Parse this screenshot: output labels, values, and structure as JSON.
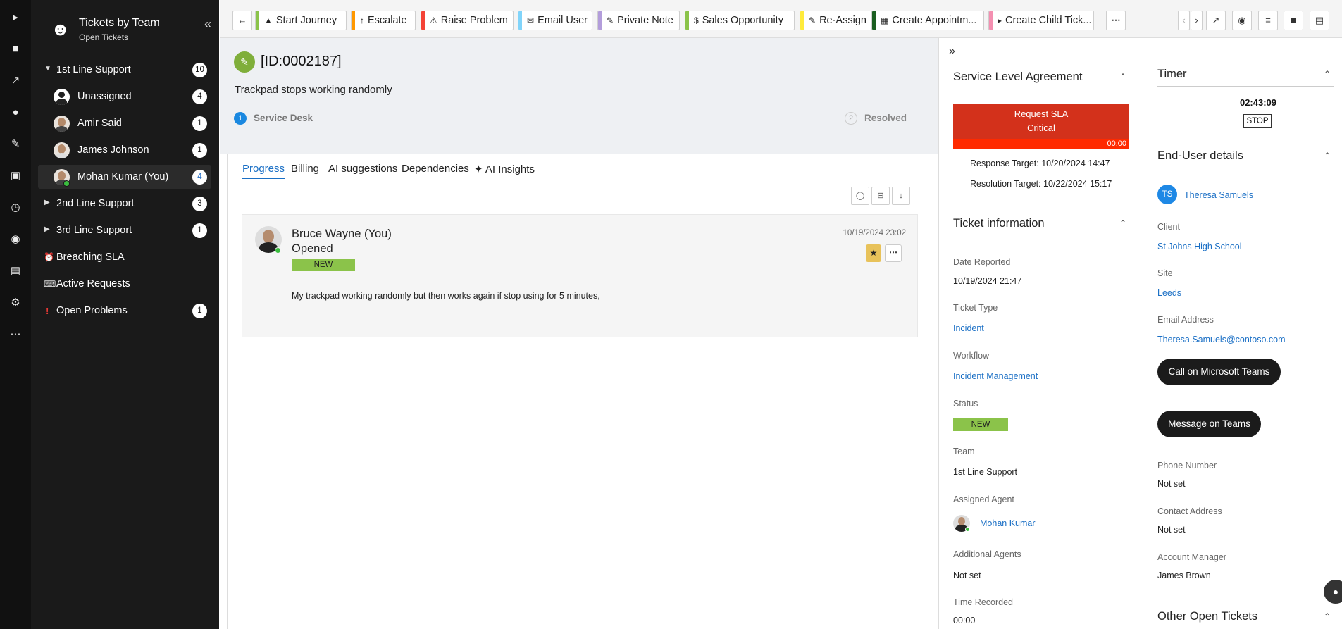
{
  "sidebar": {
    "title": "Tickets by Team",
    "subtitle": "Open Tickets",
    "items": [
      {
        "label": "1st Line Support",
        "count": "10"
      },
      {
        "label": "Unassigned",
        "count": "4"
      },
      {
        "label": "Amir Said",
        "count": "1"
      },
      {
        "label": "James Johnson",
        "count": "1"
      },
      {
        "label": "Mohan Kumar (You)",
        "count": "4"
      },
      {
        "label": "2nd Line Support",
        "count": "3"
      },
      {
        "label": "3rd Line Support",
        "count": "1"
      },
      {
        "label": "Breaching SLA",
        "count": ""
      },
      {
        "label": "Active Requests",
        "count": ""
      },
      {
        "label": "Open Problems",
        "count": "1"
      }
    ]
  },
  "toolbar": {
    "actions": [
      {
        "label": "Start Journey",
        "color": "#8bc34a",
        "icon": "car-icon"
      },
      {
        "label": "Escalate",
        "color": "#ff9800",
        "icon": "arrow-up-icon"
      },
      {
        "label": "Raise Problem",
        "color": "#f44336",
        "icon": "warning-icon"
      },
      {
        "label": "Email User",
        "color": "#81d4fa",
        "icon": "email-icon"
      },
      {
        "label": "Private Note",
        "color": "#b39ddb",
        "icon": "note-icon"
      },
      {
        "label": "Sales Opportunity",
        "color": "#8bc34a",
        "icon": "dollar-icon"
      },
      {
        "label": "Re-Assign",
        "color": "#ffeb3b",
        "icon": "edit-icon"
      },
      {
        "label": "Create Appointm...",
        "color": "#1b5e20",
        "icon": "calendar-icon"
      },
      {
        "label": "Create Child Tick...",
        "color": "#f48fb1",
        "icon": "ticket-icon"
      }
    ]
  },
  "ticket": {
    "id": "[ID:0002187]",
    "title": "Trackpad stops working randomly",
    "steps": [
      {
        "num": "1",
        "label": "Service Desk"
      },
      {
        "num": "2",
        "label": "Resolved"
      }
    ],
    "tabs": [
      "Progress",
      "Billing",
      "AI suggestions",
      "Dependencies",
      "✦ AI Insights"
    ],
    "entry": {
      "author": "Bruce Wayne (You)",
      "action": "Opened",
      "badge": "NEW",
      "date": "10/19/2024 23:02",
      "body": "My trackpad working randomly but then works again if stop using for 5 minutes,"
    }
  },
  "sla": {
    "title": "Service Level Agreement",
    "box_line1": "Request SLA",
    "box_line2": "Critical",
    "bar_time": "00:00",
    "response": "Response Target: 10/20/2024 14:47",
    "resolution": "Resolution Target: 10/22/2024 15:17"
  },
  "ticket_info": {
    "title": "Ticket information",
    "date_reported_label": "Date Reported",
    "date_reported": "10/19/2024 21:47",
    "type_label": "Ticket Type",
    "type": "Incident",
    "workflow_label": "Workflow",
    "workflow": "Incident Management",
    "status_label": "Status",
    "status": "NEW",
    "team_label": "Team",
    "team": "1st Line Support",
    "agent_label": "Assigned Agent",
    "agent": "Mohan Kumar",
    "additional_label": "Additional Agents",
    "additional": "Not set",
    "time_label": "Time Recorded",
    "time": "00:00"
  },
  "timer": {
    "title": "Timer",
    "value": "02:43:09",
    "stop": "STOP"
  },
  "end_user": {
    "title": "End-User details",
    "initials": "TS",
    "name": "Theresa Samuels",
    "client_label": "Client",
    "client": "St Johns High School",
    "site_label": "Site",
    "site": "Leeds",
    "email_label": "Email Address",
    "email": "Theresa.Samuels@contoso.com",
    "call_btn": "Call on Microsoft Teams",
    "msg_btn": "Message on Teams",
    "phone_label": "Phone Number",
    "phone": "Not set",
    "address_label": "Contact Address",
    "address": "Not set",
    "manager_label": "Account Manager",
    "manager": "James Brown"
  },
  "other_open": {
    "title": "Other Open Tickets"
  }
}
